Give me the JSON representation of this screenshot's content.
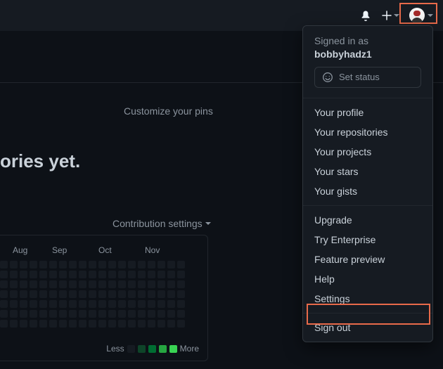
{
  "topbar": {
    "notifications_icon": "bell-icon",
    "add_icon": "plus-icon",
    "avatar": "user-avatar"
  },
  "content": {
    "customize_pins": "Customize your pins",
    "no_repos_heading": "ories yet.",
    "contribution_settings": "Contribution settings"
  },
  "graph": {
    "months": [
      "Aug",
      "Sep",
      "Oct",
      "Nov"
    ],
    "legend_less": "Less",
    "legend_more": "More"
  },
  "dropdown": {
    "signed_in_as": "Signed in as",
    "username": "bobbyhadz1",
    "set_status": "Set status",
    "group1": [
      "Your profile",
      "Your repositories",
      "Your projects",
      "Your stars",
      "Your gists"
    ],
    "group2": [
      "Upgrade",
      "Try Enterprise",
      "Feature preview",
      "Help",
      "Settings"
    ],
    "group3": [
      "Sign out"
    ]
  }
}
